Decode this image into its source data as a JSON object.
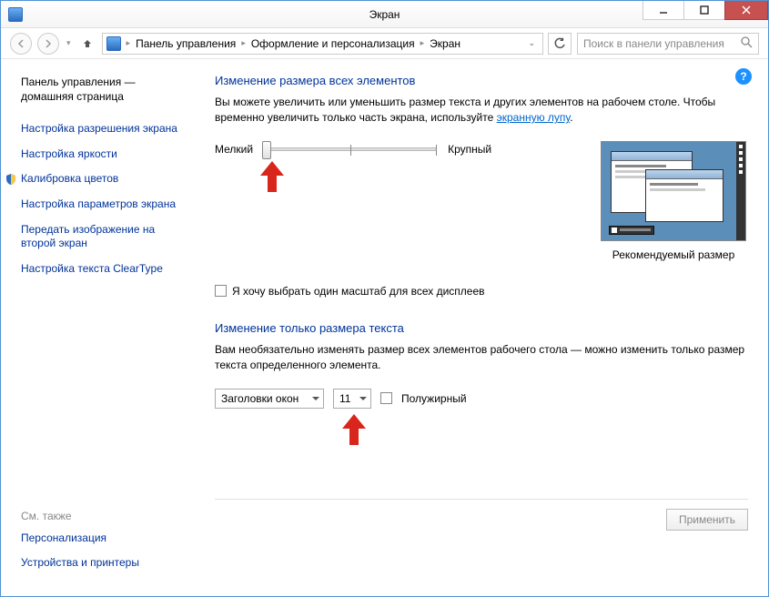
{
  "window": {
    "title": "Экран"
  },
  "breadcrumb": {
    "seg1": "Панель управления",
    "seg2": "Оформление и персонализация",
    "seg3": "Экран"
  },
  "search": {
    "placeholder": "Поиск в панели управления"
  },
  "sidebar": {
    "home1": "Панель управления —",
    "home2": "домашняя страница",
    "items": [
      "Настройка разрешения экрана",
      "Настройка яркости",
      "Калибровка цветов",
      "Настройка параметров экрана",
      "Передать изображение на второй экран",
      "Настройка текста ClearType"
    ],
    "seealso_heading": "См. также",
    "seealso": [
      "Персонализация",
      "Устройства и принтеры"
    ]
  },
  "section1": {
    "heading": "Изменение размера всех элементов",
    "desc_a": "Вы можете увеличить или уменьшить размер текста и других элементов на рабочем столе. Чтобы временно увеличить только часть экрана, используйте ",
    "desc_link": "экранную лупу",
    "desc_b": ".",
    "slider_min": "Мелкий",
    "slider_max": "Крупный",
    "preview_caption": "Рекомендуемый размер",
    "checkbox_label": "Я хочу выбрать один масштаб для всех дисплеев"
  },
  "section2": {
    "heading": "Изменение только размера текста",
    "desc": "Вам необязательно изменять размер всех элементов рабочего стола — можно изменить только размер текста определенного элемента.",
    "element_selected": "Заголовки окон",
    "size_selected": "11",
    "bold_label": "Полужирный"
  },
  "buttons": {
    "apply": "Применить"
  }
}
